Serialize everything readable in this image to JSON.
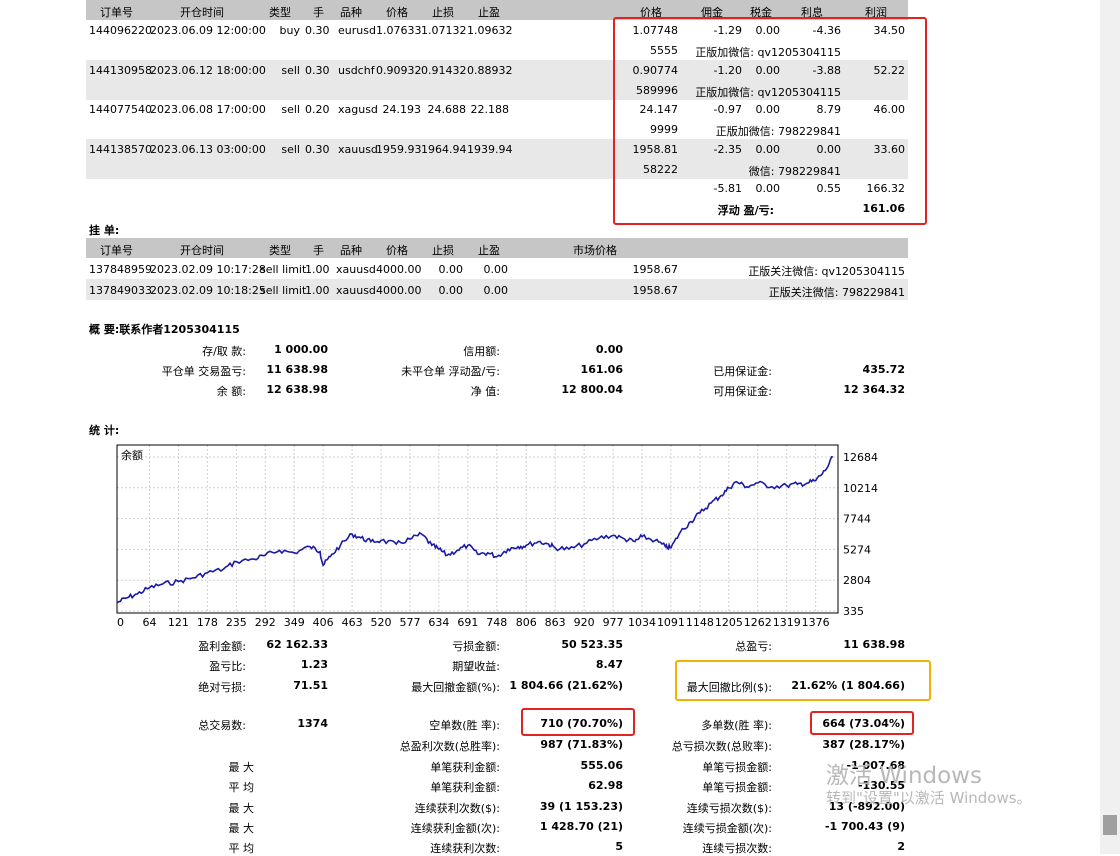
{
  "positions": {
    "headers": [
      "订单号",
      "开仓时间",
      "类型",
      "手",
      "品种",
      "价格",
      "止损",
      "止盈",
      "价格",
      "佣金",
      "税金",
      "利息",
      "利润"
    ],
    "rows": [
      {
        "order": "144096220",
        "time": "2023.06.09 12:00:00",
        "type": "buy",
        "lots": "0.30",
        "symbol": "eurusd",
        "price": "1.07633",
        "sl": "1.07132",
        "tp": "1.09632",
        "cur_price": "1.07748",
        "commission": "-1.29",
        "taxes": "0.00",
        "swap": "-4.36",
        "profit": "34.50",
        "sub_left": "5555",
        "sub_note": "正版加微信: qv1205304115"
      },
      {
        "order": "144130958",
        "time": "2023.06.12 18:00:00",
        "type": "sell",
        "lots": "0.30",
        "symbol": "usdchf",
        "price": "0.90932",
        "sl": "0.91432",
        "tp": "0.88932",
        "cur_price": "0.90774",
        "commission": "-1.20",
        "taxes": "0.00",
        "swap": "-3.88",
        "profit": "52.22",
        "sub_left": "589996",
        "sub_note": "正版加微信: qv1205304115"
      },
      {
        "order": "144077540",
        "time": "2023.06.08 17:00:00",
        "type": "sell",
        "lots": "0.20",
        "symbol": "xagusd",
        "price": "24.193",
        "sl": "24.688",
        "tp": "22.188",
        "cur_price": "24.147",
        "commission": "-0.97",
        "taxes": "0.00",
        "swap": "8.79",
        "profit": "46.00",
        "sub_left": "9999",
        "sub_note": "正版加微信: 798229841"
      },
      {
        "order": "144138570",
        "time": "2023.06.13 03:00:00",
        "type": "sell",
        "lots": "0.30",
        "symbol": "xauusd",
        "price": "1959.93",
        "sl": "1964.94",
        "tp": "1939.94",
        "cur_price": "1958.81",
        "commission": "-2.35",
        "taxes": "0.00",
        "swap": "0.00",
        "profit": "33.60",
        "sub_left": "58222",
        "sub_note": "微信: 798229841"
      }
    ],
    "totals": {
      "commission": "-5.81",
      "taxes": "0.00",
      "swap": "0.55",
      "profit": "166.32"
    },
    "floating_label": "浮动 盈/亏:",
    "floating_value": "161.06"
  },
  "pending": {
    "title": "挂 单:",
    "headers": [
      "订单号",
      "开仓时间",
      "类型",
      "手",
      "品种",
      "价格",
      "止损",
      "止盈",
      "市场价格"
    ],
    "rows": [
      {
        "order": "137848959",
        "time": "2023.02.09 10:17:28",
        "type": "sell limit",
        "lots": "1.00",
        "symbol": "xauusd",
        "price": "4000.00",
        "sl": "0.00",
        "tp": "0.00",
        "market": "1958.67",
        "note": "正版关注微信: qv1205304115"
      },
      {
        "order": "137849033",
        "time": "2023.02.09 10:18:25",
        "type": "sell limit",
        "lots": "1.00",
        "symbol": "xauusd",
        "price": "4000.00",
        "sl": "0.00",
        "tp": "0.00",
        "market": "1958.67",
        "note": "正版关注微信: 798229841"
      }
    ]
  },
  "summary": {
    "title": "概 要:联系作者1205304115",
    "items": [
      {
        "label": "存/取 款:",
        "value": "1 000.00"
      },
      {
        "label": "信用额:",
        "value": "0.00"
      },
      {
        "label": "平仓单 交易盈亏:",
        "value": "11 638.98"
      },
      {
        "label": "未平仓单 浮动盈/亏:",
        "value": "161.06"
      },
      {
        "label": "已用保证金:",
        "value": "435.72"
      },
      {
        "label": "余 额:",
        "value": "12 638.98"
      },
      {
        "label": "净 值:",
        "value": "12 800.04"
      },
      {
        "label": "可用保证金:",
        "value": "12 364.32"
      }
    ]
  },
  "stats_title": "统 计:",
  "chart_data": {
    "type": "line",
    "title": "余额",
    "x_ticks": [
      "0",
      "64",
      "121",
      "178",
      "235",
      "292",
      "349",
      "406",
      "463",
      "520",
      "577",
      "634",
      "691",
      "748",
      "806",
      "863",
      "920",
      "977",
      "1034",
      "1091",
      "1148",
      "1205",
      "1262",
      "1319",
      "1376"
    ],
    "y_ticks": [
      "12684",
      "10214",
      "7744",
      "5274",
      "2804",
      "335"
    ],
    "ylim": [
      335,
      12684
    ],
    "xlim": [
      0,
      1420
    ],
    "grid": true,
    "series": [
      {
        "x": [
          0,
          20,
          40,
          64,
          90,
          121,
          150,
          178,
          210,
          235,
          270,
          292,
          320,
          349,
          380,
          400,
          406,
          420,
          440,
          463,
          480,
          500,
          520,
          550,
          577,
          600,
          620,
          634,
          650,
          670,
          691,
          710,
          730,
          748,
          770,
          790,
          806,
          830,
          850,
          863,
          890,
          920,
          950,
          977,
          1000,
          1020,
          1034,
          1060,
          1080,
          1091,
          1110,
          1130,
          1148,
          1170,
          1190,
          1205,
          1220,
          1240,
          1262,
          1290,
          1319,
          1340,
          1360,
          1376,
          1395,
          1410
        ],
        "y": [
          1000,
          1400,
          1700,
          2200,
          2500,
          2700,
          3000,
          3400,
          3700,
          4300,
          4500,
          4800,
          5200,
          5000,
          5500,
          5100,
          4000,
          4700,
          5600,
          6500,
          6200,
          5900,
          6000,
          5700,
          6100,
          6500,
          5600,
          5300,
          4800,
          5200,
          5600,
          4900,
          5000,
          4700,
          5300,
          5500,
          5600,
          5900,
          5700,
          5400,
          5300,
          5700,
          6200,
          6400,
          6100,
          5900,
          6300,
          6000,
          5500,
          5400,
          6700,
          7500,
          8200,
          9000,
          9600,
          10200,
          10700,
          10300,
          10600,
          10300,
          10400,
          10500,
          10600,
          10800,
          11600,
          12684
        ],
        "color": "#1a1aa6"
      }
    ]
  },
  "stats": {
    "profit_total": {
      "label": "盈利金额:",
      "value": "62 162.33"
    },
    "loss_total": {
      "label": "亏损金额:",
      "value": "50 523.35"
    },
    "net_total": {
      "label": "总盈亏:",
      "value": "11 638.98"
    },
    "profit_factor": {
      "label": "盈亏比:",
      "value": "1.23"
    },
    "expected": {
      "label": "期望收益:",
      "value": "8.47"
    },
    "abs_dd": {
      "label": "绝对亏损:",
      "value": "71.51"
    },
    "max_dd": {
      "label": "最大回撤金额(%):",
      "value": "1 804.66 (21.62%)"
    },
    "max_dd_pct": {
      "label": "最大回撤比例($):",
      "value": "21.62% (1 804.66)"
    },
    "total_trades": {
      "label": "总交易数:",
      "value": "1374"
    },
    "short": {
      "label": "空单数(胜 率):",
      "value": "710 (70.70%)"
    },
    "long": {
      "label": "多单数(胜 率):",
      "value": "664 (73.04%)"
    },
    "profit_trades": {
      "label": "总盈利次数(总胜率):",
      "value": "987 (71.83%)"
    },
    "loss_trades": {
      "label": "总亏损次数(总败率):",
      "value": "387 (28.17%)"
    },
    "largest_label": "最 大",
    "largest_profit": {
      "label": "单笔获利金额:",
      "value": "555.06"
    },
    "largest_loss": {
      "label": "单笔亏损金额:",
      "value": "-1 007.68"
    },
    "average_label": "平 均",
    "avg_profit": {
      "label": "单笔获利金额:",
      "value": "62.98"
    },
    "avg_loss": {
      "label": "单笔亏损金额:",
      "value": "-130.55"
    },
    "max_label": "最 大",
    "max_cons_wins": {
      "label": "连续获利次数($):",
      "value": "39 (1 153.23)"
    },
    "max_cons_losses": {
      "label": "连续亏损次数($):",
      "value": "13 (-892.00)"
    },
    "max2_label": "最 大",
    "max_cons_profit": {
      "label": "连续获利金额(次):",
      "value": "1 428.70 (21)"
    },
    "max_cons_loss": {
      "label": "连续亏损金额(次):",
      "value": "-1 700.43 (9)"
    },
    "avg2_label": "平 均",
    "avg_cons_wins": {
      "label": "连续获利次数:",
      "value": "5"
    },
    "avg_cons_losses": {
      "label": "连续亏损次数:",
      "value": "2"
    }
  },
  "watermark": {
    "line1": "激活 Windows",
    "line2": "转到\"设置\"以激活 Windows。"
  },
  "colors": {
    "header_bg": "#c6c6c6",
    "row_alt": "#e8e8e8",
    "highlight_red": "#e32222",
    "highlight_yellow": "#f2b200",
    "line": "#1a1aa6"
  }
}
